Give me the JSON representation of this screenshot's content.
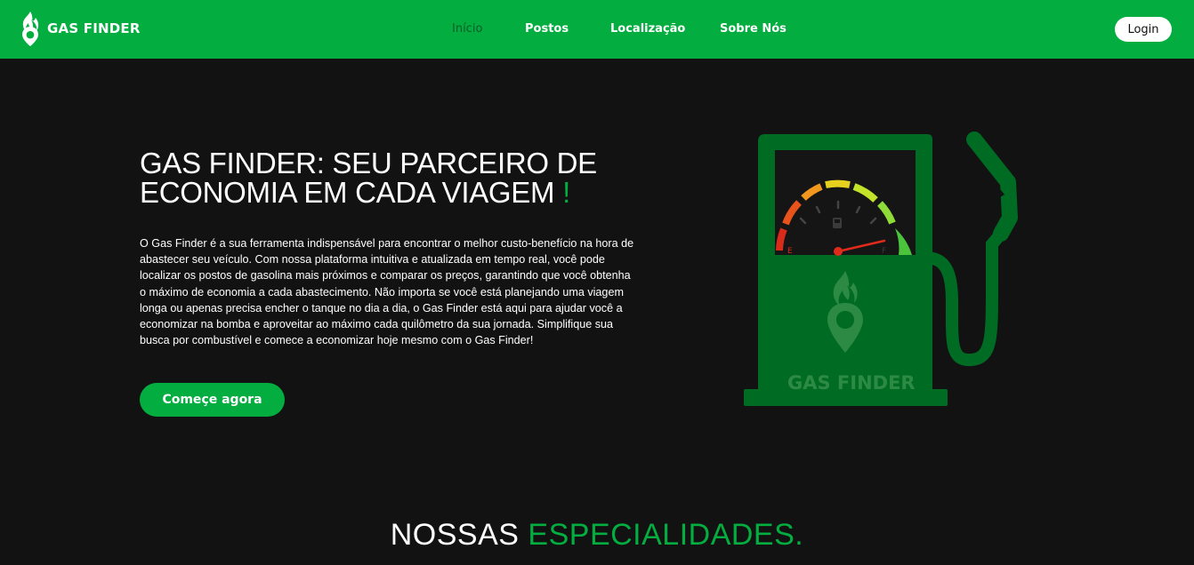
{
  "brand": {
    "name": "GAS FINDER",
    "logo_icon": "flame-pin-icon"
  },
  "nav": {
    "items": [
      {
        "label": "Início",
        "active": true
      },
      {
        "label": "Postos",
        "active": false
      },
      {
        "label": "Localização",
        "active": false
      },
      {
        "label": "Sobre Nós",
        "active": false
      }
    ],
    "login_label": "Login"
  },
  "hero": {
    "title_main": "GAS FINDER: SEU PARCEIRO DE ECONOMIA EM CADA VIAGEM",
    "title_mark": "!",
    "description": "O Gas Finder é a sua ferramenta indispensável para encontrar o melhor custo-benefício na hora de abastecer seu veículo. Com nossa plataforma intuitiva e atualizada em tempo real, você pode localizar os postos de gasolina mais próximos e comparar os preços, garantindo que você obtenha o máximo de economia a cada abastecimento. Não importa se você está planejando uma viagem longa ou apenas precisa encher o tanque no dia a dia, o Gas Finder está aqui para ajudar você a economizar na bomba e aproveitar ao máximo cada quilômetro da sua jornada. Simplifique sua busca por combustível e comece a economizar hoje mesmo com o Gas Finder!",
    "cta_label": "Começe agora",
    "illustration": {
      "icon": "fuel-pump-icon",
      "gauge_empty_label": "E",
      "gauge_full_label": "F",
      "pump_brand": "GAS FINDER"
    }
  },
  "section": {
    "title_main": "NOSSAS",
    "title_accent": "ESPECIALIDADES."
  },
  "colors": {
    "brand_green": "#03ad3f",
    "dark_green": "#006b23",
    "background": "#121212"
  }
}
